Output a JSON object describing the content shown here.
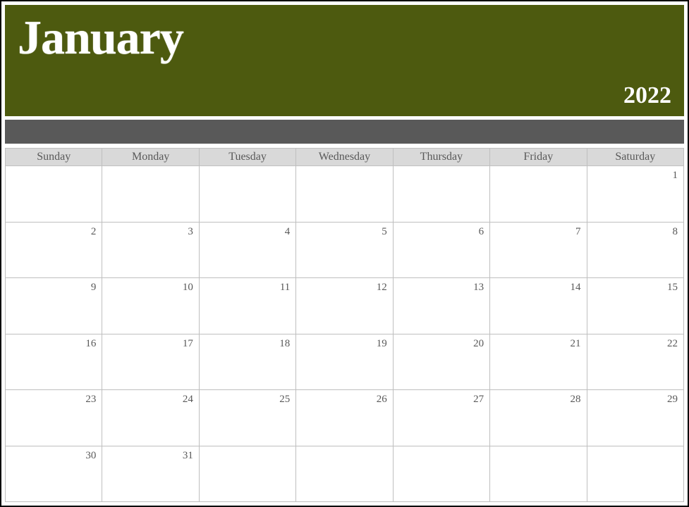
{
  "header": {
    "month": "January",
    "year": "2022"
  },
  "day_headers": [
    "Sunday",
    "Monday",
    "Tuesday",
    "Wednesday",
    "Thursday",
    "Friday",
    "Saturday"
  ],
  "weeks": [
    [
      "",
      "",
      "",
      "",
      "",
      "",
      "1"
    ],
    [
      "2",
      "3",
      "4",
      "5",
      "6",
      "7",
      "8"
    ],
    [
      "9",
      "10",
      "11",
      "12",
      "13",
      "14",
      "15"
    ],
    [
      "16",
      "17",
      "18",
      "19",
      "20",
      "21",
      "22"
    ],
    [
      "23",
      "24",
      "25",
      "26",
      "27",
      "28",
      "29"
    ],
    [
      "30",
      "31",
      "",
      "",
      "",
      "",
      ""
    ]
  ]
}
